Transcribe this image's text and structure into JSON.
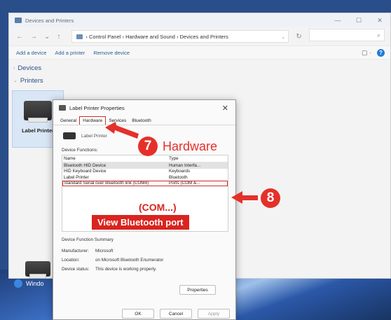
{
  "explorer": {
    "title": "Devices and Printers",
    "controls": [
      "—",
      "☐",
      "✕"
    ],
    "nav": {
      "back": "←",
      "forward": "→",
      "down": "⌄",
      "up": "↑"
    },
    "breadcrumb": "›  Control Panel  ›  Hardware and Sound  ›  Devices and Printers",
    "address_dropdown": "⌄",
    "refresh": "↻",
    "search_icon": "⌕",
    "commands": [
      "Add a device",
      "Add a printer",
      "Remove device"
    ],
    "view_icon": "▢ ·",
    "help": "?",
    "sections": {
      "devices": "Devices",
      "printers": "Printers"
    },
    "tile_label": "Label Printer",
    "taskbar_item": "Windo"
  },
  "dialog": {
    "title": "Label Printer Properties",
    "close": "✕",
    "tabs": [
      "General",
      "Hardware",
      "Services",
      "Bluetooth"
    ],
    "device_name": "Label Printer",
    "functions_label": "Device Functions:",
    "columns": [
      "Name",
      "Type"
    ],
    "rows": [
      {
        "name": "Bluetooth HID Device",
        "type": "Human Interfa..."
      },
      {
        "name": "HID Keyboard Device",
        "type": "Keyboards"
      },
      {
        "name": "Label Printer",
        "type": "Bluetooth"
      },
      {
        "name": "Standard Serial over Bluetooth link (COM4)",
        "type": "Ports (COM &..."
      }
    ],
    "summary": {
      "title": "Device Function Summary",
      "manufacturer_label": "Manufacturer:",
      "manufacturer": "Microsoft",
      "location_label": "Location:",
      "location": "on Microsoft Bluetooth Enumerator",
      "status_label": "Device status:",
      "status": "This device is working properly."
    },
    "buttons": {
      "properties": "Properties",
      "ok": "OK",
      "cancel": "Cancel",
      "apply": "Apply"
    }
  },
  "annotations": {
    "step7": "7",
    "step7_label": "Hardware",
    "step8": "8",
    "com_label": "(COM...)",
    "banner": "View Bluetooth port"
  }
}
